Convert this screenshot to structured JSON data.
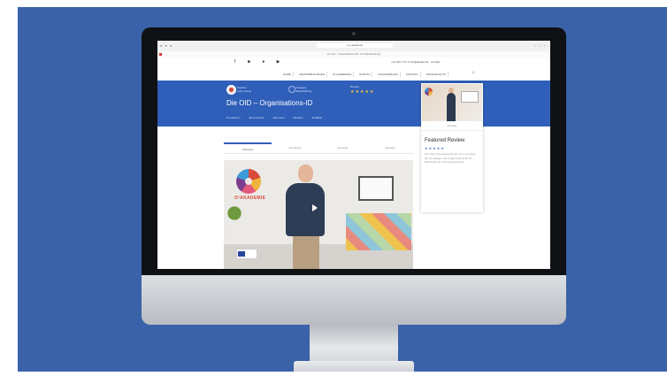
{
  "browser": {
    "url": "o-n-akademie",
    "notice": "Auf der · Organisations-ID · Ihr Weiterbildung",
    "traffic_icons": "● ● ●",
    "right_icons": "□ □ +"
  },
  "topbar": {
    "social_icons": "f ■ ● ▶",
    "contact": "+49 345 7 91 ✉ info@akademie  · Kontakt"
  },
  "nav": {
    "items": [
      "HOME",
      "WEITERBILDUNGEN",
      "ALLGEMEINES",
      "EVENTS",
      "FINANZIERUNG",
      "KONTAKT",
      "DATENSCHUTZ"
    ],
    "search_icon": "⌕"
  },
  "course": {
    "teacher_label": "Teacher",
    "teacher_name": "Autor Name",
    "category_label": "Category",
    "category_value": "Weiterbildung",
    "review_label": "Review",
    "stars": "★★★★★",
    "title": "Die OID – Organisations-ID",
    "meta": [
      "5 Lektionen",
      "28 Lernende",
      "Alle Level",
      "Deutsch",
      "Zertifikat"
    ]
  },
  "tabs": [
    "Overview",
    "Curriculum",
    "Instructor",
    "Reviews"
  ],
  "video": {
    "brand": "O²AKADEMIE",
    "play_icon": "play-icon"
  },
  "sidebar_card": {
    "preview_label": "Preview",
    "featured_title": "Featured Review",
    "featured_stars": "★★★★★",
    "featured_text": "Die OID und entsprechende Kurs vermittelt die Grundlagen der Organisations-ID für Mitarbeitende und Organisationen."
  },
  "colors": {
    "background": "#3a62a8",
    "hero": "#2f5fb8",
    "accent": "#f3c44b"
  }
}
